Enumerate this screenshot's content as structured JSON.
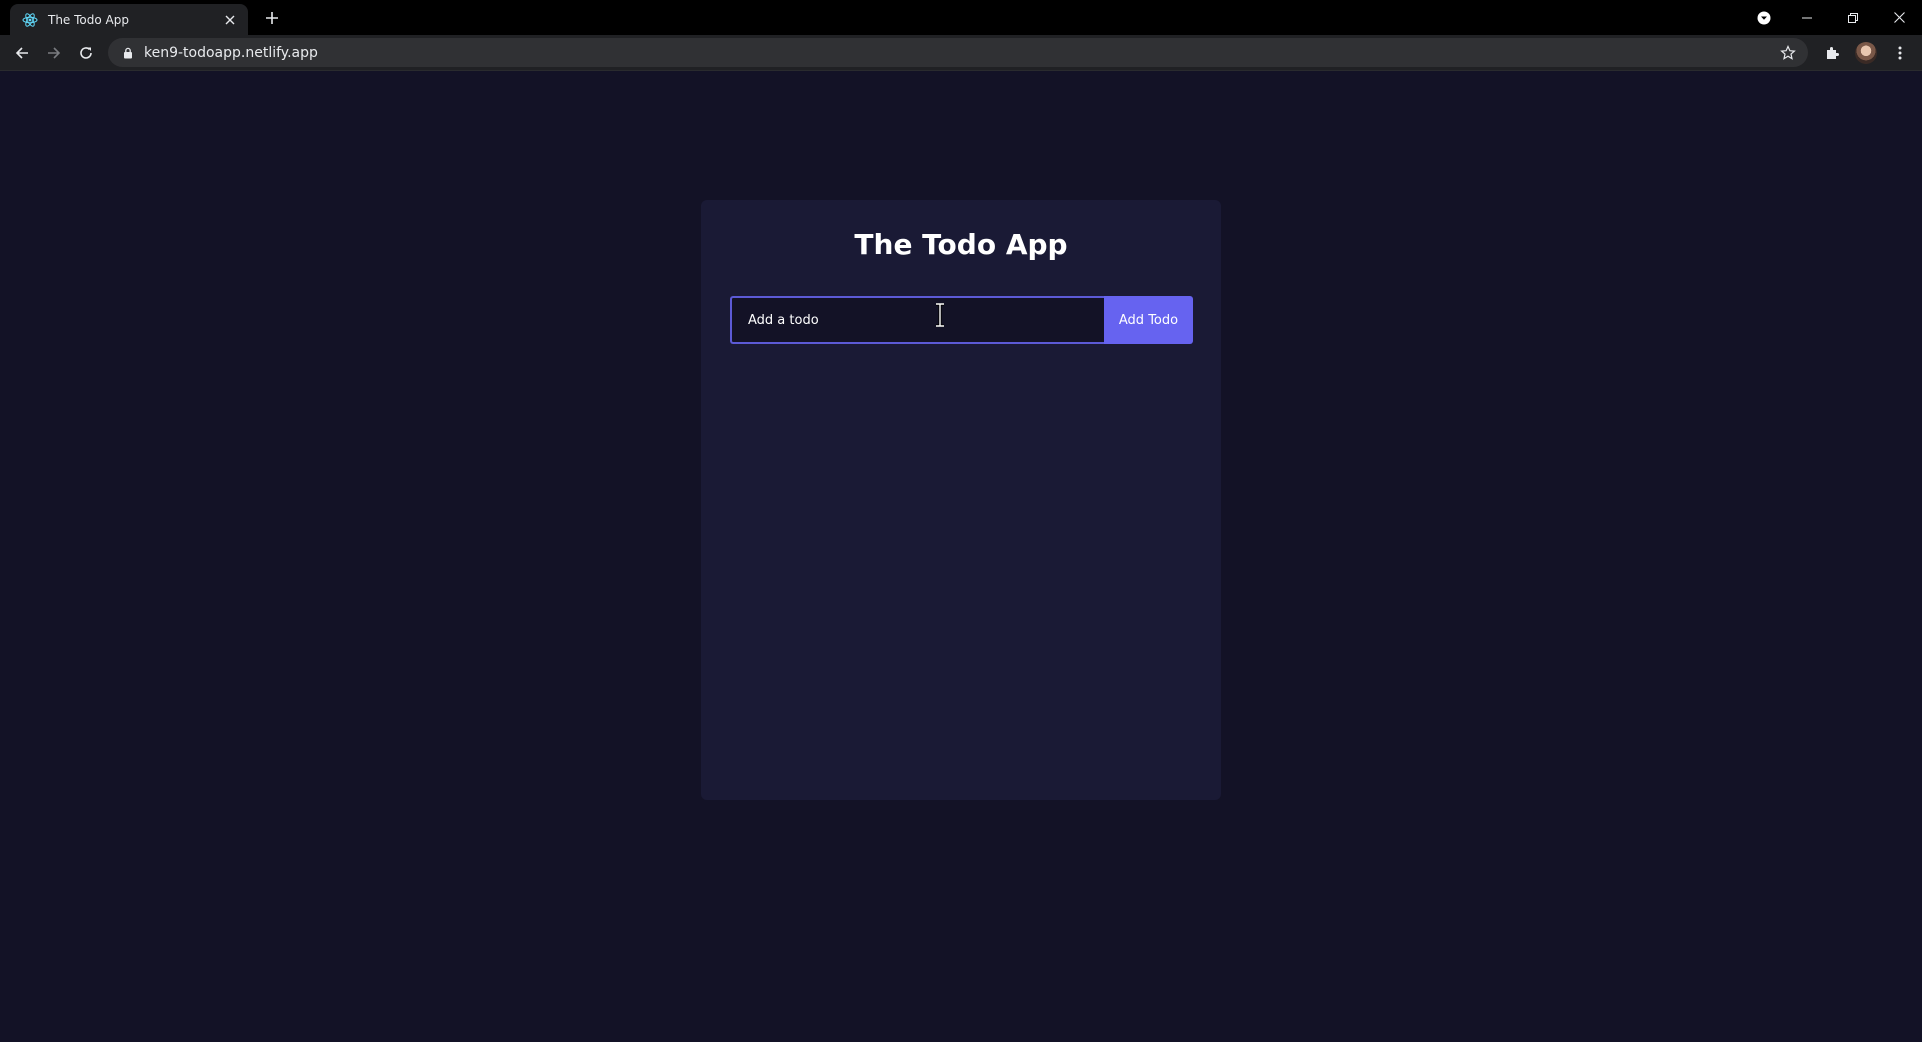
{
  "browser": {
    "tab": {
      "title": "The Todo App",
      "favicon": "react-icon"
    },
    "address_bar": {
      "url": "ken9-todoapp.netlify.app"
    }
  },
  "app": {
    "title": "The Todo App",
    "input": {
      "placeholder": "Add a todo",
      "value": ""
    },
    "add_button_label": "Add Todo"
  },
  "colors": {
    "page_background": "#131226",
    "card_background": "#1a1a35",
    "accent": "#6663f0",
    "input_border": "#5c5ad6"
  }
}
